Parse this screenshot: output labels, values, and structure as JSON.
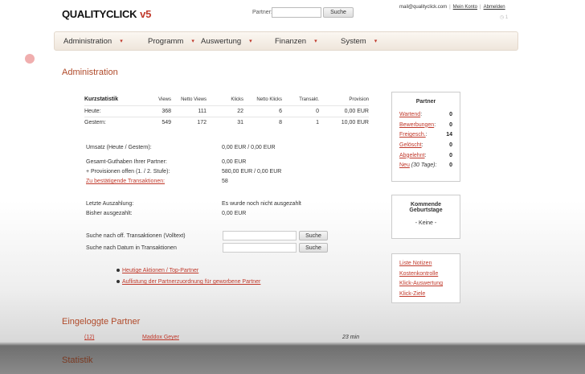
{
  "header": {
    "logo_main": "QUALITYCLICK",
    "logo_version": "v5",
    "partner_label": "Partner:",
    "partner_input_value": "",
    "search_button": "Suche",
    "email": "mail@qualityclick.com",
    "my_account": "Mein Konto",
    "logout": "Abmelden",
    "corner_text": "◷ 1"
  },
  "nav": {
    "items": [
      {
        "label": "Administration"
      },
      {
        "label": "Programm"
      },
      {
        "label": "Auswertung"
      },
      {
        "label": "Finanzen"
      },
      {
        "label": "System"
      }
    ],
    "arrow": "▾"
  },
  "admin": {
    "title": "Administration",
    "stats": {
      "headers": [
        "Kurzstatistik",
        "Views",
        "Netto Views",
        "Klicks",
        "Netto Klicks",
        "Transakt.",
        "Provision"
      ],
      "rows": [
        [
          "Heute:",
          "368",
          "111",
          "22",
          "6",
          "0",
          "0,00 EUR"
        ],
        [
          "Gestern:",
          "549",
          "172",
          "31",
          "8",
          "1",
          "10,00 EUR"
        ]
      ]
    },
    "umsatz_label": "Umsatz (Heute / Gestern):",
    "umsatz_value": "0,00 EUR / 0,00 EUR",
    "guthaben_label": "Gesamt-Guthaben Ihrer Partner:",
    "guthaben_value": "0,00 EUR",
    "provisionen_label": "+ Provisionen offen (1. / 2. Stufe):",
    "provisionen_value": "580,00 EUR / 0,00 EUR",
    "transaktionen_label": "Zu bestätigende Transaktionen:",
    "transaktionen_value": "58",
    "auszahlung_label": "Letzte Auszahlung:",
    "auszahlung_value": "Es wurde noch nicht ausgezahlt",
    "ausgezahlt_label": "Bisher ausgezahlt:",
    "ausgezahlt_value": "0,00 EUR",
    "search1_label": "Suche nach off. Transaktionen (Volltext)",
    "search2_label": "Suche nach Datum in Transaktionen",
    "search_button": "Suche",
    "link1": "Heutige Aktionen / Top-Partner",
    "link2": "Auflistung der Partnerzuordnung für geworbene Partner"
  },
  "partner_box": {
    "title": "Partner",
    "rows": [
      {
        "label": "Wartend",
        "suffix": ":",
        "value": "0"
      },
      {
        "label": "Bewerbungen",
        "suffix": ":",
        "value": "0"
      },
      {
        "label": "Freigesch.",
        "suffix": ":",
        "value": "14"
      },
      {
        "label": "Gelöscht",
        "suffix": ":",
        "value": "0"
      },
      {
        "label": "Abgelehnt",
        "suffix": ":",
        "value": "0"
      },
      {
        "label": "Neu",
        "suffix": " (30 Tage):",
        "value": "0"
      }
    ]
  },
  "birthday_box": {
    "title_line1": "Kommende",
    "title_line2": "Geburtstage",
    "value": "- Keine -"
  },
  "links_box": {
    "items": [
      "Liste Notizen",
      "Kostenkontrolle",
      "Klick-Auswertung",
      "Klick-Ziele"
    ]
  },
  "eingeloggt": {
    "title": "Eingeloggte Partner",
    "count": "(12)",
    "name": "Maddox Geyer",
    "time": "23 min"
  },
  "statistik": {
    "title": "Statistik"
  },
  "colors": {
    "accent": "#c0392b",
    "heading": "#b04a2a"
  }
}
